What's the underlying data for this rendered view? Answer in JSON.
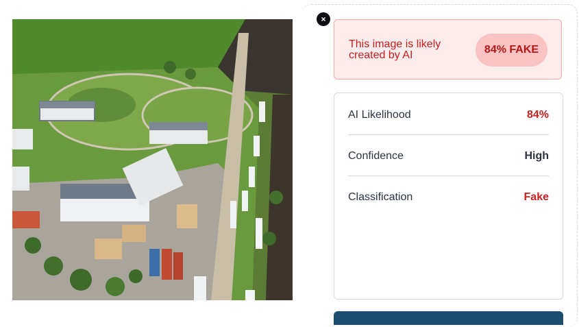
{
  "dialog": {
    "close_symbol": "×",
    "close_icon": "close-icon"
  },
  "result": {
    "message": "This image is likely created by AI",
    "badge": "84% FAKE",
    "colors": {
      "alert_bg": "#fdecec",
      "alert_text": "#c81d1d",
      "badge_bg": "#f9c3c3"
    }
  },
  "stats": {
    "rows": [
      {
        "label": "AI Likelihood",
        "value": "84%",
        "color": "#cc1f1f"
      },
      {
        "label": "Confidence",
        "value": "High",
        "color": "#2b3440"
      },
      {
        "label": "Classification",
        "value": "Fake",
        "color": "#cc1f1f"
      }
    ]
  },
  "analyzed_image": {
    "subject": "aerial-view-estate-with-trucks"
  }
}
